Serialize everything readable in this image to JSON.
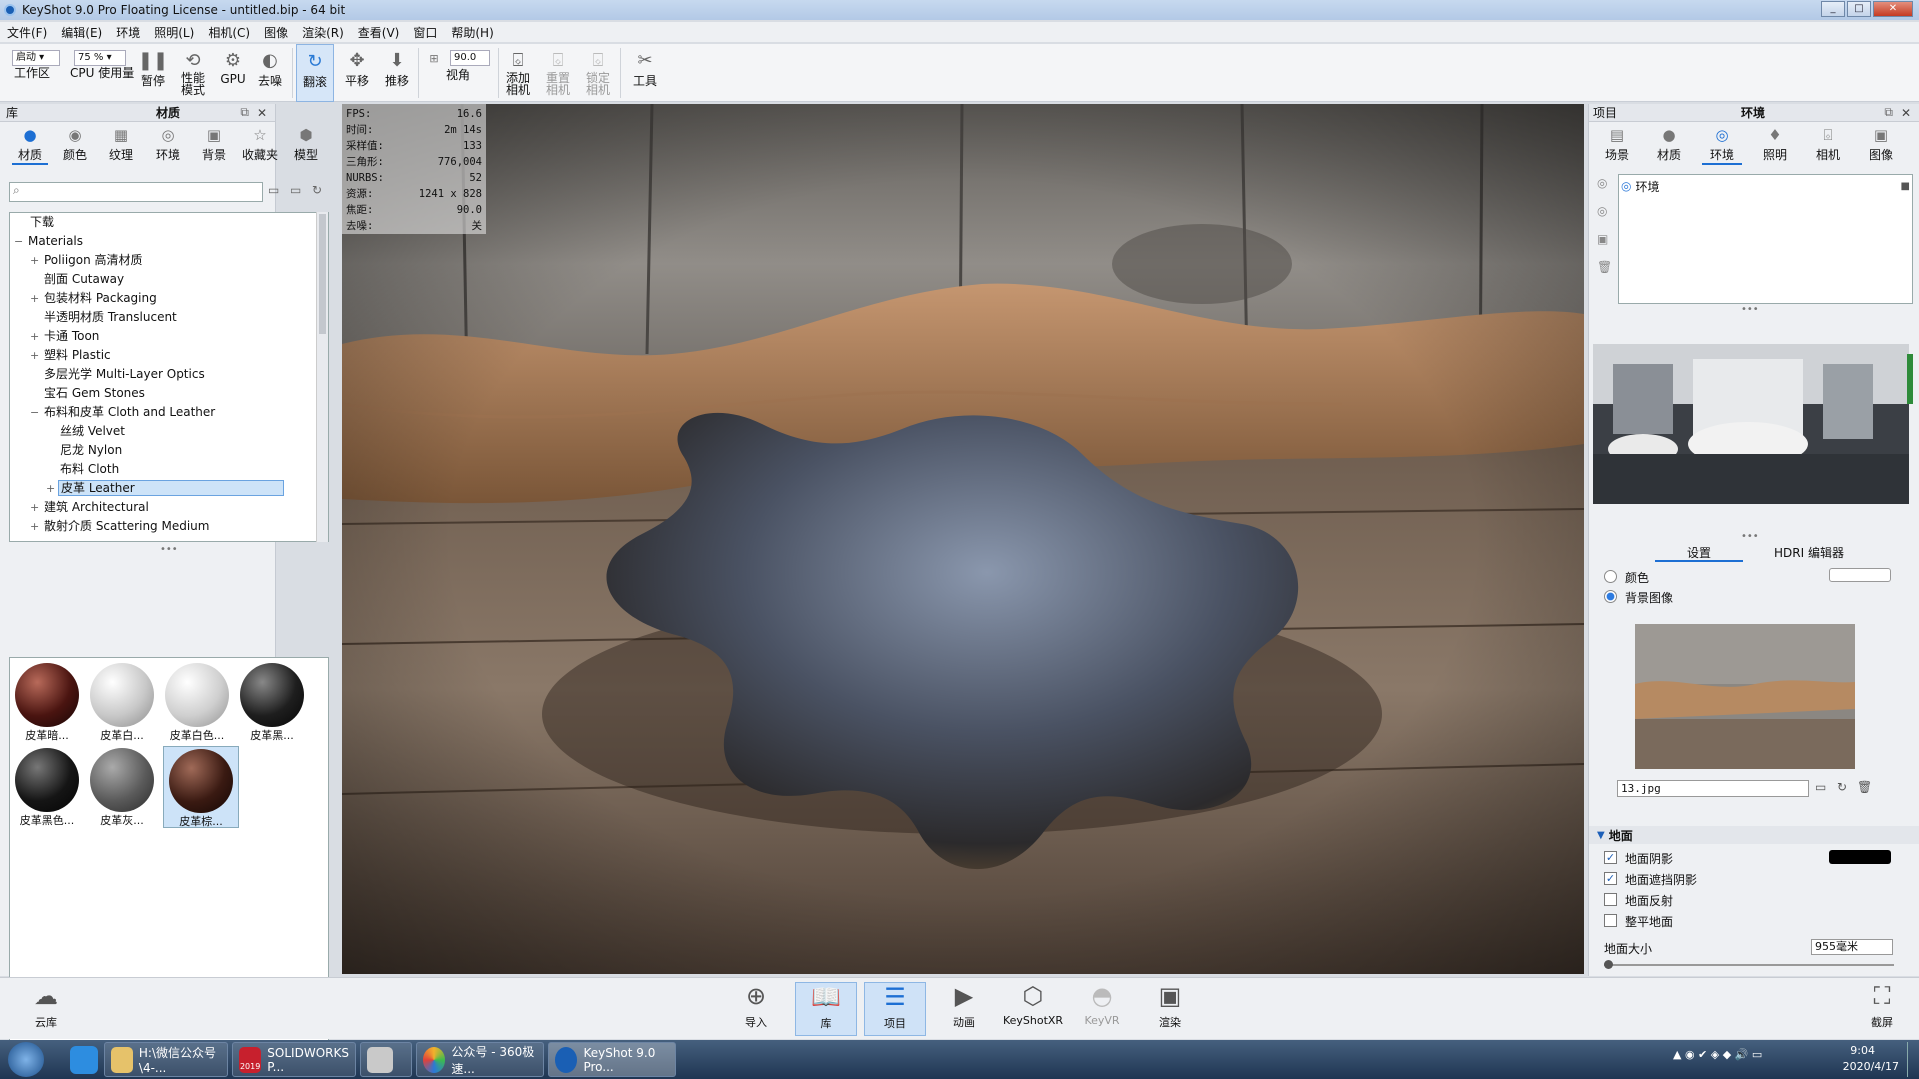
{
  "window": {
    "title": "KeyShot 9.0 Pro Floating License  - untitled.bip  - 64 bit",
    "btn_min": "_",
    "btn_max": "□",
    "btn_close": "✕"
  },
  "menu": [
    "文件(F)",
    "编辑(E)",
    "环境",
    "照明(L)",
    "相机(C)",
    "图像",
    "渲染(R)",
    "查看(V)",
    "窗口",
    "帮助(H)"
  ],
  "toolbar": {
    "workspace_value": "启动",
    "workspace_label": "工作区",
    "cpu_value": "75 %",
    "cpu_label": "CPU 使用量",
    "pause": "暂停",
    "perf_line1": "性能",
    "perf_line2": "模式",
    "gpu": "GPU",
    "denoise": "去噪",
    "tumble": "翻滚",
    "pan": "平移",
    "dolly": "推移",
    "fov_value": "90.0",
    "fov_label": "视角",
    "add_cam_1": "添加",
    "add_cam_2": "相机",
    "reset_cam_1": "重置",
    "reset_cam_2": "相机",
    "lock_cam_1": "锁定",
    "lock_cam_2": "相机",
    "tools": "工具"
  },
  "library": {
    "panel_label": "库",
    "panel_title": "材质",
    "tabs": [
      "材质",
      "颜色",
      "纹理",
      "环境",
      "背景",
      "收藏夹",
      "模型"
    ],
    "tree": [
      {
        "label": "下载",
        "level": 1,
        "toggle": ""
      },
      {
        "label": "Materials",
        "level": 0,
        "toggle": "−"
      },
      {
        "label": "Poliigon 高清材质",
        "level": 1,
        "toggle": "+"
      },
      {
        "label": "剖面 Cutaway",
        "level": 1,
        "toggle": ""
      },
      {
        "label": "包装材料 Packaging",
        "level": 1,
        "toggle": "+"
      },
      {
        "label": "半透明材质 Translucent",
        "level": 1,
        "toggle": ""
      },
      {
        "label": "卡通 Toon",
        "level": 1,
        "toggle": "+"
      },
      {
        "label": "塑料 Plastic",
        "level": 1,
        "toggle": "+"
      },
      {
        "label": "多层光学 Multi-Layer Optics",
        "level": 1,
        "toggle": ""
      },
      {
        "label": "宝石 Gem Stones",
        "level": 1,
        "toggle": ""
      },
      {
        "label": "布料和皮革 Cloth and Leather",
        "level": 1,
        "toggle": "−"
      },
      {
        "label": "丝绒 Velvet",
        "level": 2,
        "toggle": ""
      },
      {
        "label": "尼龙 Nylon",
        "level": 2,
        "toggle": ""
      },
      {
        "label": "布料 Cloth",
        "level": 2,
        "toggle": ""
      },
      {
        "label": "皮革 Leather",
        "level": 2,
        "toggle": "+"
      },
      {
        "label": "建筑 Architectural",
        "level": 1,
        "toggle": "+"
      },
      {
        "label": "散射介质 Scattering Medium",
        "level": 1,
        "toggle": "+"
      }
    ],
    "thumbnails": [
      "皮革暗...",
      "皮革白...",
      "皮革白色...",
      "皮革黑...",
      "皮革黑色...",
      "皮革灰...",
      "皮革棕..."
    ],
    "thumb_colors": [
      "#4a1410",
      "#c8c8c8",
      "#cfcfcf",
      "#1e1e1e",
      "#151515",
      "#5a5a5a",
      "#3a1a12"
    ]
  },
  "stats": [
    {
      "k": "FPS:",
      "v": "16.6"
    },
    {
      "k": "时间:",
      "v": "2m 14s"
    },
    {
      "k": "采样值:",
      "v": "133"
    },
    {
      "k": "三角形:",
      "v": "776,004"
    },
    {
      "k": "NURBS:",
      "v": "52"
    },
    {
      "k": "资源:",
      "v": "1241 x 828"
    },
    {
      "k": "焦距:",
      "v": "90.0"
    },
    {
      "k": "去噪:",
      "v": "关"
    }
  ],
  "project": {
    "panel_label": "项目",
    "panel_title": "环境",
    "tabs": [
      "场景",
      "材质",
      "环境",
      "照明",
      "相机",
      "图像"
    ],
    "env_item": "环境",
    "sub_tabs": [
      "设置",
      "HDRI 编辑器"
    ],
    "bg_color": "颜色",
    "bg_image": "背景图像",
    "bg_file": "13.jpg",
    "ground_section": "地面",
    "ground_shadow": "地面阴影",
    "ground_occlusion": "地面遮挡阴影",
    "ground_reflection": "地面反射",
    "flatten_ground": "整平地面",
    "ground_size_label": "地面大小",
    "ground_size_value": "955毫米"
  },
  "bottom": {
    "cloud": "云库",
    "buttons": [
      "导入",
      "库",
      "项目",
      "动画",
      "KeyShotXR",
      "KeyVR",
      "渲染"
    ],
    "screenshot": "截屏"
  },
  "taskbar": {
    "items": [
      "H:\\微信公众号\\4-...",
      "SOLIDWORKS P...",
      "",
      "公众号 - 360极速...",
      "KeyShot 9.0 Pro..."
    ],
    "time": "9:04",
    "date": "2020/4/17",
    "sw_year": "2019"
  }
}
